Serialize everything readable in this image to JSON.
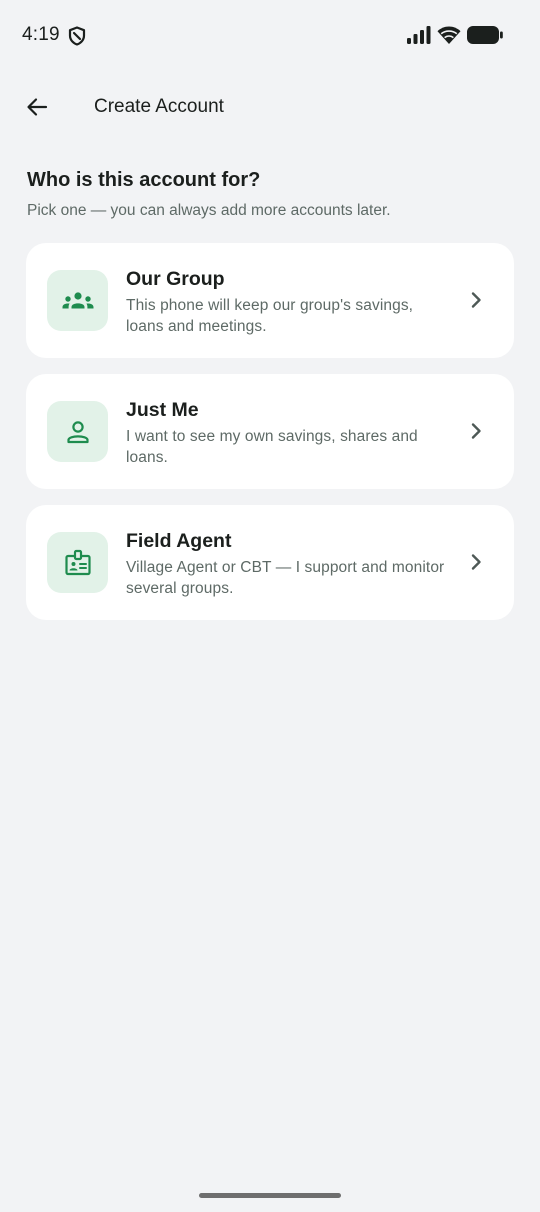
{
  "status_bar": {
    "time": "4:19",
    "icons": [
      "shield-icon",
      "signal-icon",
      "wifi-icon",
      "battery-icon"
    ]
  },
  "app_bar": {
    "back_icon": "arrow-left-icon",
    "title": "Create Account"
  },
  "main": {
    "heading": "Who is this account for?",
    "subtext": "Pick one — you can always add more accounts later.",
    "options": [
      {
        "icon": "group-icon",
        "title": "Our Group",
        "description": "This phone will keep our group's savings, loans and meetings."
      },
      {
        "icon": "person-icon",
        "title": "Just Me",
        "description": "I want to see my own savings, shares and loans."
      },
      {
        "icon": "badge-icon",
        "title": "Field Agent",
        "description": "Village Agent or CBT — I support and monitor several groups."
      }
    ]
  },
  "colors": {
    "background": "#F2F3F5",
    "card": "#FFFFFF",
    "accent_green": "#1E8C4E",
    "icon_tile": "#E2F2E8",
    "text_primary": "#1B1F1D",
    "text_secondary": "#5E6A66"
  }
}
